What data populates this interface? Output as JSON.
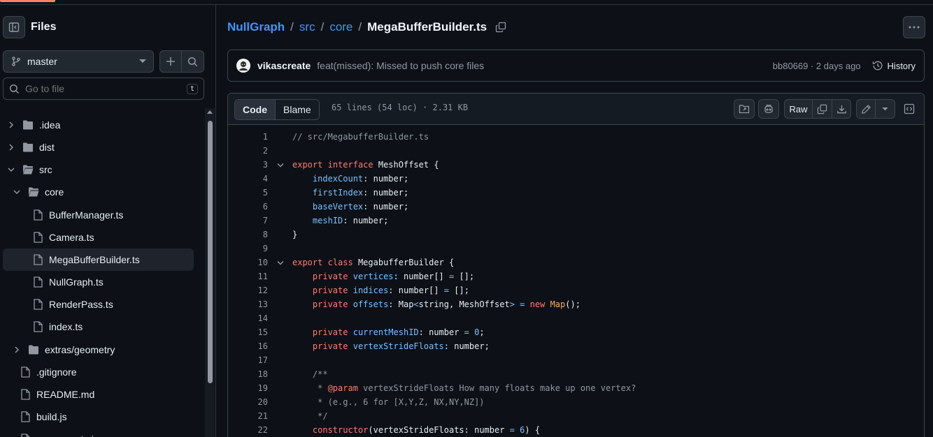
{
  "sidebar": {
    "title": "Files",
    "branch": "master",
    "goto_placeholder": "Go to file",
    "goto_shortcut": "t",
    "tree": [
      {
        "name": ".idea",
        "type": "folder",
        "depth": 0,
        "expanded": false
      },
      {
        "name": "dist",
        "type": "folder",
        "depth": 0,
        "expanded": false
      },
      {
        "name": "src",
        "type": "folder",
        "depth": 0,
        "expanded": true
      },
      {
        "name": "core",
        "type": "folder",
        "depth": 1,
        "expanded": true
      },
      {
        "name": "BufferManager.ts",
        "type": "file",
        "depth": 2
      },
      {
        "name": "Camera.ts",
        "type": "file",
        "depth": 2
      },
      {
        "name": "MegaBufferBuilder.ts",
        "type": "file",
        "depth": 2,
        "selected": true
      },
      {
        "name": "NullGraph.ts",
        "type": "file",
        "depth": 2
      },
      {
        "name": "RenderPass.ts",
        "type": "file",
        "depth": 2
      },
      {
        "name": "index.ts",
        "type": "file",
        "depth": 2
      },
      {
        "name": "extras/geometry",
        "type": "folder",
        "depth": 1,
        "expanded": false
      },
      {
        "name": ".gitignore",
        "type": "file",
        "depth": 0
      },
      {
        "name": "README.md",
        "type": "file",
        "depth": 0
      },
      {
        "name": "build.js",
        "type": "file",
        "depth": 0
      },
      {
        "name": "copy-assets.js",
        "type": "file",
        "depth": 0
      }
    ]
  },
  "breadcrumb": {
    "repo": "NullGraph",
    "parts": [
      "src",
      "core"
    ],
    "separator": "/",
    "current": "MegaBufferBuilder.ts"
  },
  "commit": {
    "author": "vikascreate",
    "message": "feat(missed): Missed to push core files",
    "meta": "bb80669 · 2 days ago",
    "history_label": "History"
  },
  "file": {
    "tab_code": "Code",
    "tab_blame": "Blame",
    "info": "65 lines (54 loc) · 2.31 KB",
    "raw_label": "Raw"
  },
  "code_lines": [
    {
      "n": "1",
      "fold": false,
      "tokens": [
        [
          "c",
          "// src/MegabufferBuilder.ts"
        ]
      ]
    },
    {
      "n": "2",
      "fold": false,
      "tokens": []
    },
    {
      "n": "3",
      "fold": true,
      "tokens": [
        [
          "k",
          "export"
        ],
        [
          "s",
          " "
        ],
        [
          "k",
          "interface"
        ],
        [
          "s",
          " MeshOffset {"
        ]
      ]
    },
    {
      "n": "4",
      "fold": false,
      "tokens": [
        [
          "s",
          "    "
        ],
        [
          "p",
          "indexCount"
        ],
        [
          "s",
          ": number;"
        ]
      ]
    },
    {
      "n": "5",
      "fold": false,
      "tokens": [
        [
          "s",
          "    "
        ],
        [
          "p",
          "firstIndex"
        ],
        [
          "s",
          ": number;"
        ]
      ]
    },
    {
      "n": "6",
      "fold": false,
      "tokens": [
        [
          "s",
          "    "
        ],
        [
          "p",
          "baseVertex"
        ],
        [
          "s",
          ": number;"
        ]
      ]
    },
    {
      "n": "7",
      "fold": false,
      "tokens": [
        [
          "s",
          "    "
        ],
        [
          "p",
          "meshID"
        ],
        [
          "s",
          ": number;"
        ]
      ]
    },
    {
      "n": "8",
      "fold": false,
      "tokens": [
        [
          "s",
          "}"
        ]
      ]
    },
    {
      "n": "9",
      "fold": false,
      "tokens": []
    },
    {
      "n": "10",
      "fold": true,
      "tokens": [
        [
          "k",
          "export"
        ],
        [
          "s",
          " "
        ],
        [
          "k",
          "class"
        ],
        [
          "s",
          " MegabufferBuilder {"
        ]
      ]
    },
    {
      "n": "11",
      "fold": false,
      "tokens": [
        [
          "s",
          "    "
        ],
        [
          "k",
          "private"
        ],
        [
          "s",
          " "
        ],
        [
          "p",
          "vertices"
        ],
        [
          "s",
          ": number[] "
        ],
        [
          "o",
          "="
        ],
        [
          "s",
          " [];"
        ]
      ]
    },
    {
      "n": "12",
      "fold": false,
      "tokens": [
        [
          "s",
          "    "
        ],
        [
          "k",
          "private"
        ],
        [
          "s",
          " "
        ],
        [
          "p",
          "indices"
        ],
        [
          "s",
          ": number[] "
        ],
        [
          "o",
          "="
        ],
        [
          "s",
          " [];"
        ]
      ]
    },
    {
      "n": "13",
      "fold": false,
      "tokens": [
        [
          "s",
          "    "
        ],
        [
          "k",
          "private"
        ],
        [
          "s",
          " "
        ],
        [
          "p",
          "offsets"
        ],
        [
          "s",
          ": Map"
        ],
        [
          "o",
          "<"
        ],
        [
          "s",
          "string, MeshOffset"
        ],
        [
          "o",
          ">"
        ],
        [
          "s",
          " "
        ],
        [
          "o",
          "="
        ],
        [
          "s",
          " "
        ],
        [
          "k",
          "new"
        ],
        [
          "s",
          " "
        ],
        [
          "e",
          "Map"
        ],
        [
          "s",
          "();"
        ]
      ]
    },
    {
      "n": "14",
      "fold": false,
      "tokens": []
    },
    {
      "n": "15",
      "fold": false,
      "tokens": [
        [
          "s",
          "    "
        ],
        [
          "k",
          "private"
        ],
        [
          "s",
          " "
        ],
        [
          "p",
          "currentMeshID"
        ],
        [
          "s",
          ": number "
        ],
        [
          "o",
          "="
        ],
        [
          "s",
          " "
        ],
        [
          "p",
          "0"
        ],
        [
          "s",
          ";"
        ]
      ]
    },
    {
      "n": "16",
      "fold": false,
      "tokens": [
        [
          "s",
          "    "
        ],
        [
          "k",
          "private"
        ],
        [
          "s",
          " "
        ],
        [
          "p",
          "vertexStrideFloats"
        ],
        [
          "s",
          ": number;"
        ]
      ]
    },
    {
      "n": "17",
      "fold": false,
      "tokens": []
    },
    {
      "n": "18",
      "fold": false,
      "tokens": [
        [
          "c",
          "    /**"
        ]
      ]
    },
    {
      "n": "19",
      "fold": false,
      "tokens": [
        [
          "c",
          "     * "
        ],
        [
          "k",
          "@param"
        ],
        [
          "c",
          " vertexStrideFloats How many floats make up one vertex?"
        ]
      ]
    },
    {
      "n": "20",
      "fold": false,
      "tokens": [
        [
          "c",
          "     * (e.g., 6 for [X,Y,Z, NX,NY,NZ])"
        ]
      ]
    },
    {
      "n": "21",
      "fold": false,
      "tokens": [
        [
          "c",
          "     */"
        ]
      ]
    },
    {
      "n": "22",
      "fold": false,
      "tokens": [
        [
          "s",
          "    "
        ],
        [
          "k",
          "constructor"
        ],
        [
          "s",
          "(vertexStrideFloats: number "
        ],
        [
          "o",
          "="
        ],
        [
          "s",
          " "
        ],
        [
          "p",
          "6"
        ],
        [
          "s",
          ") {"
        ]
      ]
    }
  ]
}
